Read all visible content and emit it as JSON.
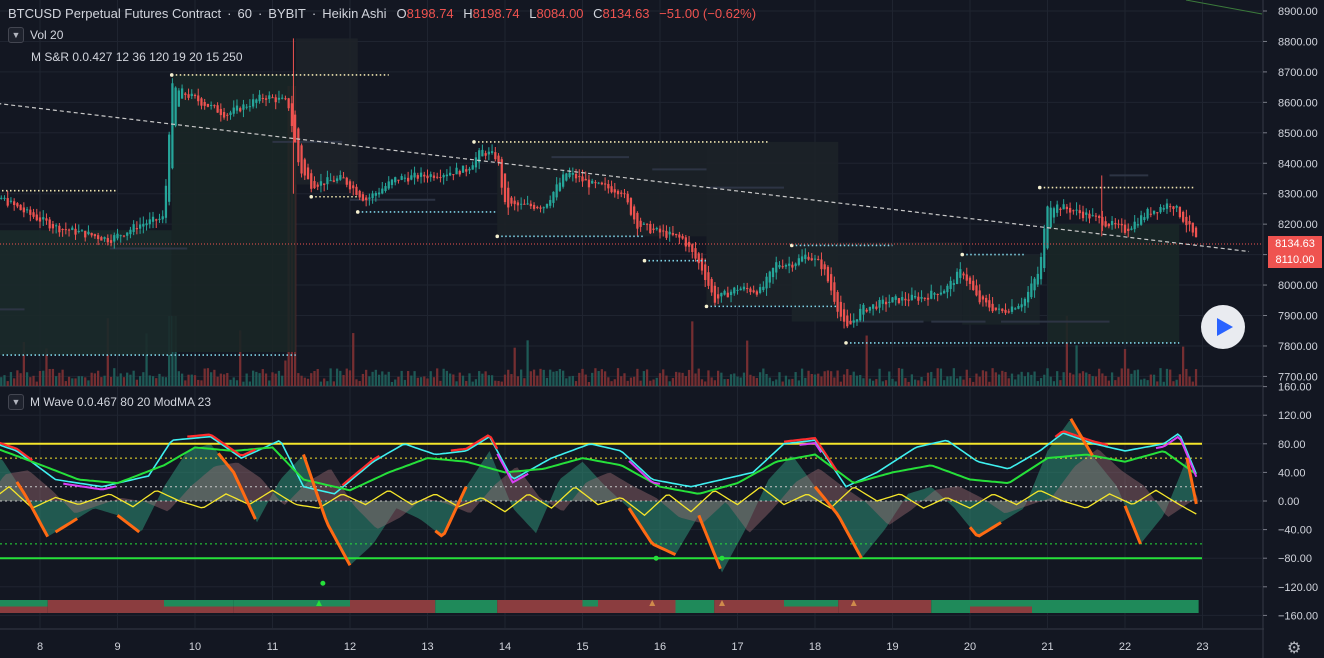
{
  "header": {
    "symbol": "BTCUSD Perpetual Futures Contract",
    "interval": "60",
    "exchange": "BYBIT",
    "chart_style": "Heikin Ashi",
    "open_key": "O",
    "open": "8198.74",
    "high_key": "H",
    "high": "8198.74",
    "low_key": "L",
    "low": "8084.00",
    "close_key": "C",
    "close": "8134.63",
    "change": "−51.00 (−0.62%)"
  },
  "legends": {
    "volume": "Vol 20",
    "msr": "M S&R 0.0.427 12 36 120 19 20 15 250",
    "wave": "M Wave 0.0.467 80 20 ModMA 23"
  },
  "price_tags": {
    "current": "8134.63",
    "support": "8110.00"
  },
  "colors": {
    "background": "#131722",
    "up": "#26a69a",
    "down": "#ef5350",
    "grid": "#1f2430",
    "wave_yellow": "#f5e62b",
    "wave_green": "#26e03a",
    "wave_cyan": "#3ff0f0",
    "wave_magenta": "#d93ff5",
    "wave_orange": "#ff6a13",
    "wave_red": "#ff2d2d"
  },
  "icons": {
    "play": "play-icon",
    "settings": "gear-icon",
    "collapse": "chevron-down-icon"
  },
  "chart_data": [
    {
      "type": "candlestick",
      "title": "BTCUSD Perpetual Futures Contract · 60 · BYBIT · Heikin Ashi",
      "ylim": [
        7650,
        8930
      ],
      "y_ticks": [
        "8900.00",
        "8800.00",
        "8700.00",
        "8600.00",
        "8500.00",
        "8400.00",
        "8300.00",
        "8200.00",
        "8100.00",
        "8000.00",
        "7900.00",
        "7800.00",
        "7700.00"
      ],
      "x_ticks": [
        "8",
        "9",
        "10",
        "11",
        "12",
        "13",
        "14",
        "15",
        "16",
        "17",
        "18",
        "19",
        "20",
        "21",
        "22",
        "23"
      ],
      "price_path_anchors": [
        [
          7.0,
          7900
        ],
        [
          7.4,
          8300
        ],
        [
          7.8,
          8240
        ],
        [
          8.2,
          8190
        ],
        [
          8.9,
          8150
        ],
        [
          9.3,
          8200
        ],
        [
          9.6,
          8220
        ],
        [
          9.7,
          8650
        ],
        [
          10.4,
          8560
        ],
        [
          10.9,
          8620
        ],
        [
          11.2,
          8600
        ],
        [
          11.35,
          8380
        ],
        [
          11.5,
          8330
        ],
        [
          11.9,
          8350
        ],
        [
          12.2,
          8280
        ],
        [
          12.6,
          8350
        ],
        [
          13.0,
          8360
        ],
        [
          13.5,
          8380
        ],
        [
          13.7,
          8440
        ],
        [
          13.9,
          8420
        ],
        [
          14.0,
          8260
        ],
        [
          14.5,
          8260
        ],
        [
          14.8,
          8370
        ],
        [
          15.1,
          8330
        ],
        [
          15.5,
          8310
        ],
        [
          15.7,
          8200
        ],
        [
          15.9,
          8180
        ],
        [
          16.3,
          8150
        ],
        [
          16.55,
          8050
        ],
        [
          16.7,
          7950
        ],
        [
          17.0,
          7990
        ],
        [
          17.3,
          7980
        ],
        [
          17.5,
          8070
        ],
        [
          17.7,
          8070
        ],
        [
          17.9,
          8100
        ],
        [
          18.1,
          8060
        ],
        [
          18.3,
          7920
        ],
        [
          18.4,
          7850
        ],
        [
          18.6,
          7920
        ],
        [
          19.0,
          7950
        ],
        [
          19.4,
          7960
        ],
        [
          19.7,
          7990
        ],
        [
          19.9,
          8050
        ],
        [
          20.1,
          7950
        ],
        [
          20.4,
          7910
        ],
        [
          20.7,
          7950
        ],
        [
          20.9,
          8050
        ],
        [
          21.0,
          8270
        ],
        [
          21.5,
          8230
        ],
        [
          21.8,
          8200
        ],
        [
          22.0,
          8180
        ],
        [
          22.3,
          8240
        ],
        [
          22.6,
          8270
        ],
        [
          22.8,
          8200
        ],
        [
          22.95,
          8134
        ]
      ],
      "support_resistance_levels": [
        {
          "from": 7.2,
          "to": 9.0,
          "y": 8310
        },
        {
          "from": 9.7,
          "to": 12.5,
          "y": 8690
        },
        {
          "from": 13.6,
          "to": 17.4,
          "y": 8470
        },
        {
          "from": 7.0,
          "to": 11.3,
          "y": 7770
        },
        {
          "from": 11.5,
          "to": 12.1,
          "y": 8290
        },
        {
          "from": 12.1,
          "to": 13.9,
          "y": 8240
        },
        {
          "from": 13.9,
          "to": 15.8,
          "y": 8160
        },
        {
          "from": 15.8,
          "to": 16.6,
          "y": 8080
        },
        {
          "from": 16.6,
          "to": 18.3,
          "y": 7930
        },
        {
          "from": 17.7,
          "to": 19.0,
          "y": 8130
        },
        {
          "from": 18.4,
          "to": 22.7,
          "y": 7810
        },
        {
          "from": 19.9,
          "to": 20.7,
          "y": 8100
        },
        {
          "from": 20.9,
          "to": 22.9,
          "y": 8320
        }
      ],
      "trendline": {
        "from": [
          7.0,
          8610
        ],
        "to": [
          23.6,
          8110
        ]
      },
      "price_line": 8134.63
    },
    {
      "type": "line",
      "title": "M Wave 0.0.467 80 20 ModMA 23",
      "ylim": [
        -180,
        180
      ],
      "y_ticks": [
        "160.00",
        "120.00",
        "80.00",
        "40.00",
        "0.00",
        "−40.00",
        "−80.00",
        "−120.00",
        "−160.00"
      ],
      "levels": [
        80,
        60,
        20,
        0,
        -60,
        -80
      ],
      "series": [
        {
          "name": "",
          "color": "#3ff0f0",
          "kind": "oscillator-fast",
          "points": [
            [
              7.0,
              40
            ],
            [
              7.3,
              85
            ],
            [
              7.7,
              70
            ],
            [
              8.2,
              30
            ],
            [
              8.8,
              20
            ],
            [
              9.4,
              35
            ],
            [
              9.7,
              85
            ],
            [
              10.2,
              90
            ],
            [
              10.6,
              60
            ],
            [
              11.1,
              85
            ],
            [
              11.4,
              20
            ],
            [
              11.8,
              10
            ],
            [
              12.3,
              55
            ],
            [
              12.7,
              80
            ],
            [
              13.1,
              65
            ],
            [
              13.5,
              70
            ],
            [
              13.8,
              90
            ],
            [
              14.1,
              30
            ],
            [
              14.6,
              60
            ],
            [
              15.1,
              80
            ],
            [
              15.5,
              70
            ],
            [
              15.9,
              30
            ],
            [
              16.4,
              20
            ],
            [
              16.8,
              30
            ],
            [
              17.2,
              40
            ],
            [
              17.6,
              80
            ],
            [
              18.0,
              85
            ],
            [
              18.4,
              20
            ],
            [
              18.8,
              40
            ],
            [
              19.3,
              75
            ],
            [
              19.7,
              85
            ],
            [
              20.1,
              55
            ],
            [
              20.5,
              45
            ],
            [
              20.9,
              70
            ],
            [
              21.2,
              95
            ],
            [
              21.6,
              80
            ],
            [
              22.0,
              70
            ],
            [
              22.5,
              80
            ],
            [
              22.7,
              95
            ],
            [
              22.95,
              30
            ]
          ]
        },
        {
          "name": "",
          "color": "#26e03a",
          "kind": "oscillator-slow",
          "points": [
            [
              7.0,
              45
            ],
            [
              7.4,
              75
            ],
            [
              7.9,
              55
            ],
            [
              8.5,
              30
            ],
            [
              9.0,
              25
            ],
            [
              9.6,
              50
            ],
            [
              10.0,
              75
            ],
            [
              10.5,
              70
            ],
            [
              11.0,
              75
            ],
            [
              11.4,
              30
            ],
            [
              12.0,
              15
            ],
            [
              12.5,
              40
            ],
            [
              13.0,
              60
            ],
            [
              13.5,
              55
            ],
            [
              14.0,
              40
            ],
            [
              14.5,
              45
            ],
            [
              15.0,
              60
            ],
            [
              15.5,
              50
            ],
            [
              16.0,
              20
            ],
            [
              16.5,
              10
            ],
            [
              17.0,
              25
            ],
            [
              17.5,
              55
            ],
            [
              18.0,
              65
            ],
            [
              18.5,
              25
            ],
            [
              19.0,
              40
            ],
            [
              19.5,
              50
            ],
            [
              20.0,
              30
            ],
            [
              20.5,
              25
            ],
            [
              21.0,
              60
            ],
            [
              21.5,
              65
            ],
            [
              22.0,
              55
            ],
            [
              22.5,
              70
            ],
            [
              22.95,
              35
            ]
          ]
        },
        {
          "name": "",
          "color": "#f5e62b",
          "kind": "signal",
          "points": [
            [
              7.0,
              5
            ],
            [
              7.3,
              -5
            ],
            [
              7.6,
              20
            ],
            [
              7.9,
              -10
            ],
            [
              8.2,
              5
            ],
            [
              8.5,
              -5
            ],
            [
              8.9,
              10
            ],
            [
              9.2,
              -8
            ],
            [
              9.5,
              15
            ],
            [
              9.8,
              0
            ],
            [
              10.1,
              -10
            ],
            [
              10.4,
              10
            ],
            [
              10.7,
              -5
            ],
            [
              11.0,
              15
            ],
            [
              11.3,
              -5
            ],
            [
              11.6,
              -10
            ],
            [
              11.9,
              10
            ],
            [
              12.2,
              -5
            ],
            [
              12.5,
              15
            ],
            [
              12.8,
              -5
            ],
            [
              13.1,
              10
            ],
            [
              13.4,
              -8
            ],
            [
              13.7,
              5
            ],
            [
              14.0,
              -15
            ],
            [
              14.3,
              10
            ],
            [
              14.6,
              -10
            ],
            [
              14.9,
              20
            ],
            [
              15.2,
              -5
            ],
            [
              15.5,
              5
            ],
            [
              15.8,
              -20
            ],
            [
              16.1,
              10
            ],
            [
              16.4,
              -15
            ],
            [
              16.7,
              15
            ],
            [
              17.0,
              -5
            ],
            [
              17.3,
              20
            ],
            [
              17.6,
              -5
            ],
            [
              17.9,
              10
            ],
            [
              18.2,
              -10
            ],
            [
              18.5,
              20
            ],
            [
              18.8,
              0
            ],
            [
              19.1,
              10
            ],
            [
              19.4,
              -10
            ],
            [
              19.7,
              5
            ],
            [
              20.0,
              -10
            ],
            [
              20.3,
              10
            ],
            [
              20.6,
              -5
            ],
            [
              20.9,
              15
            ],
            [
              21.2,
              0
            ],
            [
              21.5,
              -10
            ],
            [
              21.8,
              10
            ],
            [
              22.1,
              -5
            ],
            [
              22.4,
              15
            ],
            [
              22.7,
              -5
            ],
            [
              22.95,
              -20
            ]
          ]
        },
        {
          "name": "",
          "color": "#ff6a13",
          "kind": "wave",
          "points": [
            [
              7.0,
              -5
            ],
            [
              7.2,
              50
            ],
            [
              7.5,
              60
            ],
            [
              7.8,
              10
            ],
            [
              8.1,
              -50
            ],
            [
              8.4,
              -30
            ],
            [
              8.7,
              -10
            ],
            [
              9.0,
              -20
            ],
            [
              9.3,
              -45
            ],
            [
              9.6,
              20
            ],
            [
              9.9,
              70
            ],
            [
              10.2,
              80
            ],
            [
              10.5,
              40
            ],
            [
              10.8,
              -30
            ],
            [
              11.1,
              30
            ],
            [
              11.4,
              65
            ],
            [
              11.7,
              -30
            ],
            [
              12.0,
              -90
            ],
            [
              12.3,
              -60
            ],
            [
              12.6,
              -10
            ],
            [
              12.9,
              -25
            ],
            [
              13.2,
              -50
            ],
            [
              13.5,
              20
            ],
            [
              13.8,
              70
            ],
            [
              14.1,
              -10
            ],
            [
              14.4,
              -45
            ],
            [
              14.7,
              30
            ],
            [
              15.0,
              55
            ],
            [
              15.3,
              20
            ],
            [
              15.6,
              -10
            ],
            [
              15.9,
              -60
            ],
            [
              16.2,
              -75
            ],
            [
              16.5,
              -20
            ],
            [
              16.8,
              -100
            ],
            [
              17.1,
              -40
            ],
            [
              17.4,
              30
            ],
            [
              17.7,
              65
            ],
            [
              18.0,
              20
            ],
            [
              18.3,
              -20
            ],
            [
              18.6,
              -80
            ],
            [
              18.9,
              -40
            ],
            [
              19.2,
              10
            ],
            [
              19.5,
              20
            ],
            [
              19.8,
              -10
            ],
            [
              20.1,
              -50
            ],
            [
              20.4,
              -30
            ],
            [
              20.7,
              -10
            ],
            [
              21.0,
              70
            ],
            [
              21.3,
              115
            ],
            [
              21.6,
              60
            ],
            [
              21.9,
              20
            ],
            [
              22.2,
              -60
            ],
            [
              22.5,
              -20
            ],
            [
              22.8,
              60
            ],
            [
              22.95,
              -20
            ]
          ]
        }
      ]
    }
  ]
}
